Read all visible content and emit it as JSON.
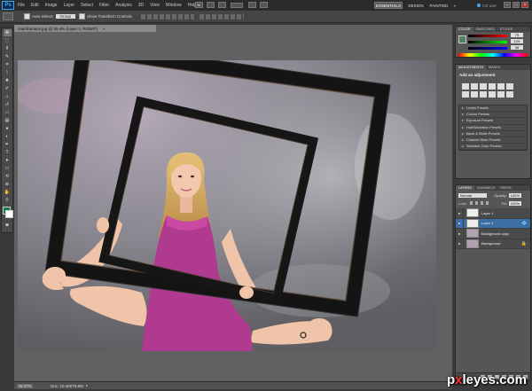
{
  "app": {
    "logo": "Ps"
  },
  "menu": [
    "File",
    "Edit",
    "Image",
    "Layer",
    "Select",
    "Filter",
    "Analysis",
    "3D",
    "View",
    "Window",
    "Help"
  ],
  "workspaces": {
    "essentials": "ESSENTIALS",
    "design": "DESIGN",
    "painting": "PAINTING",
    "more": "»"
  },
  "cs_live": "CS Live",
  "window_controls": {
    "minimize": "–",
    "maximize": "□",
    "close": "×"
  },
  "options_bar": {
    "auto_select_label": "Auto-Select:",
    "auto_select_value": "Group",
    "transform_label": "Show Transform Controls"
  },
  "document": {
    "tab_title": "mainframeps.jpg @ 36.4% (Layer 2, RGB/8*)",
    "tab_close": "×"
  },
  "status": {
    "zoom": "36.37%",
    "doc_size": "Doc: 10.4M/75.8M"
  },
  "color_panel": {
    "tabs": [
      "COLOR",
      "SWATCHES",
      "STYLES"
    ],
    "r": "79",
    "g": "129",
    "b": "98"
  },
  "adjustments_panel": {
    "tabs": [
      "ADJUSTMENTS",
      "MASKS"
    ],
    "title": "Add an adjustment",
    "presets": [
      "Levels Presets",
      "Curves Presets",
      "Exposure Presets",
      "Hue/Saturation Presets",
      "Black & White Presets",
      "Channel Mixer Presets",
      "Selective Color Presets"
    ]
  },
  "layers_panel": {
    "tabs": [
      "LAYERS",
      "CHANNELS",
      "PATHS"
    ],
    "blend_mode": "Normal",
    "opacity_label": "Opacity:",
    "opacity": "100%",
    "lock_label": "Lock:",
    "fill_label": "Fill:",
    "fill": "100%",
    "layers": [
      {
        "name": "Layer 1"
      },
      {
        "name": "Layer 2"
      },
      {
        "name": "Background copy"
      },
      {
        "name": "Background"
      }
    ]
  },
  "watermark": {
    "part1": "p",
    "x": "x",
    "part2": "leyes.com"
  },
  "colors": {
    "accent": "#3fa9f5",
    "selected_layer": "#3b6ea5",
    "dress": "#b03a8f",
    "frame": "#141414"
  }
}
